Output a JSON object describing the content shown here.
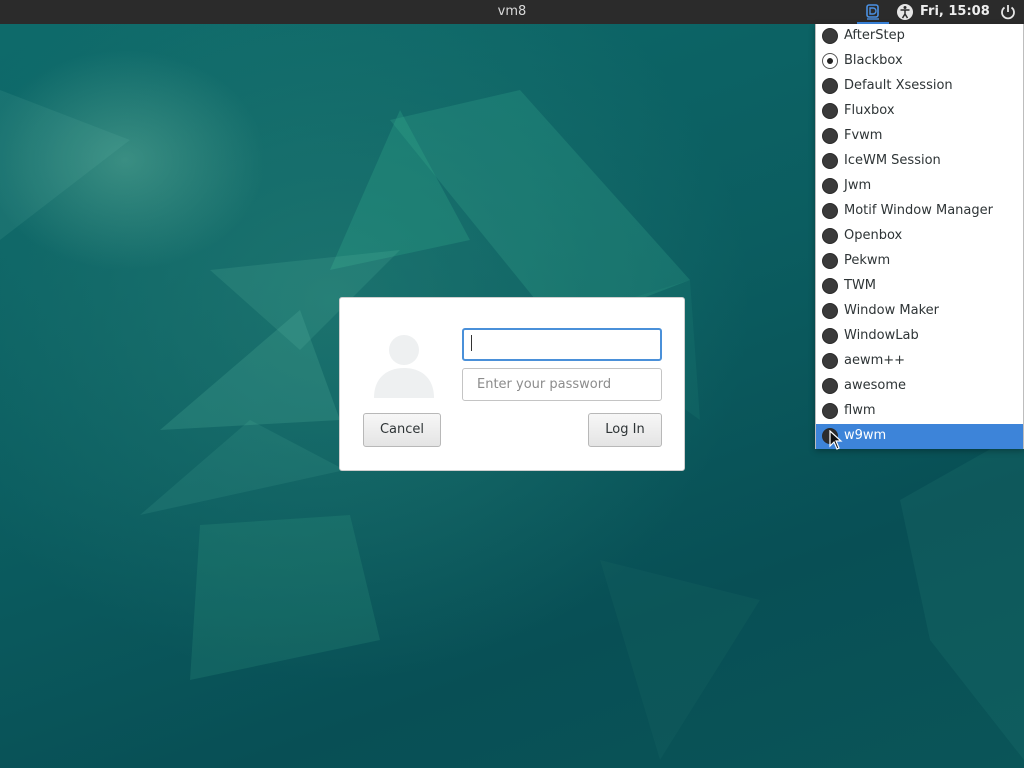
{
  "topbar": {
    "hostname": "vm8",
    "clock": "Fri, 15:08",
    "icons": [
      "session-selector-icon",
      "accessibility-icon",
      "power-icon"
    ]
  },
  "login": {
    "username_value": "",
    "password_placeholder": "Enter your password",
    "cancel_label": "Cancel",
    "login_label": "Log In"
  },
  "session_menu": {
    "items": [
      {
        "label": "AfterStep"
      },
      {
        "label": "Blackbox"
      },
      {
        "label": "Default Xsession"
      },
      {
        "label": "Fluxbox"
      },
      {
        "label": "Fvwm"
      },
      {
        "label": "IceWM Session"
      },
      {
        "label": "Jwm"
      },
      {
        "label": "Motif Window Manager"
      },
      {
        "label": "Openbox"
      },
      {
        "label": "Pekwm"
      },
      {
        "label": "TWM"
      },
      {
        "label": "Window Maker"
      },
      {
        "label": "WindowLab"
      },
      {
        "label": "aewm++"
      },
      {
        "label": "awesome"
      },
      {
        "label": "flwm"
      },
      {
        "label": "w9wm"
      }
    ],
    "selected": "Blackbox",
    "hovered": "w9wm"
  },
  "colors": {
    "topbar": "#2b2b2b",
    "accent": "#3d84d9",
    "desktop": "#0d5a5a"
  }
}
